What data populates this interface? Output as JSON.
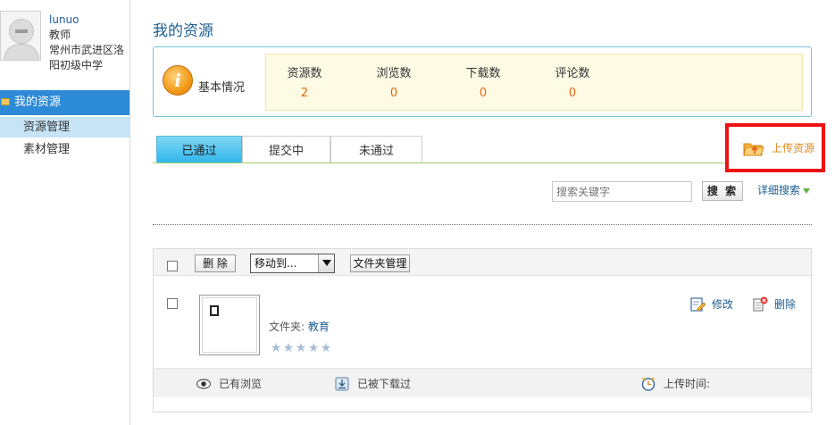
{
  "sidebar": {
    "user": {
      "name": "lunuo",
      "role": "教师",
      "school_line1": "常州市武进区洛",
      "school_line2": "阳初级中学"
    },
    "section_title": "我的资源",
    "items": [
      {
        "label": "资源管理",
        "active": true
      },
      {
        "label": "素材管理",
        "active": false
      }
    ]
  },
  "main": {
    "title": "我的资源",
    "overview": {
      "label": "基本情况",
      "stats": [
        {
          "label": "资源数",
          "value": "2"
        },
        {
          "label": "浏览数",
          "value": "0"
        },
        {
          "label": "下载数",
          "value": "0"
        },
        {
          "label": "评论数",
          "value": "0"
        }
      ]
    },
    "tabs": [
      {
        "label": "已通过",
        "active": true
      },
      {
        "label": "提交中",
        "active": false
      },
      {
        "label": "未通过",
        "active": false
      }
    ],
    "upload_label": "上传资源",
    "search": {
      "placeholder": "搜索关键字",
      "button": "搜 索",
      "advanced": "详细搜索"
    },
    "toolbar": {
      "delete": "删 除",
      "move_to": "移动到...",
      "folder_manage": "文件夹管理"
    },
    "item": {
      "folder_label": "文件夹:",
      "folder_name": "教育",
      "rating": 0,
      "rating_max": 5,
      "edit": "修改",
      "delete": "删除",
      "viewed": "已有浏览",
      "downloaded": "已被下载过",
      "upload_time": "上传时间:"
    }
  },
  "colors": {
    "accent": "#2d8ad6",
    "highlight": "#ee1111",
    "number": "#e06a12",
    "link": "#1c5e8f"
  }
}
